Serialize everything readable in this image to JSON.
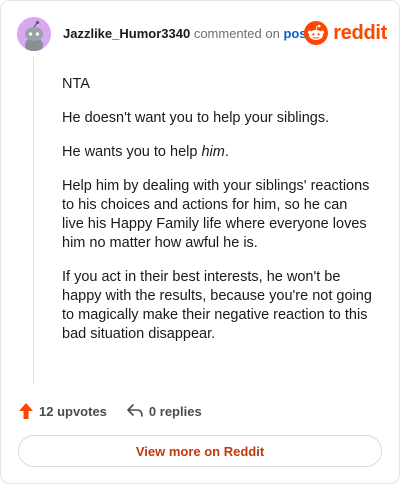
{
  "header": {
    "username": "Jazzlike_Humor3340",
    "commented_on": "commented on",
    "post_link": "post",
    "brand": "reddit",
    "avatar_icon": "snoo-avatar-icon",
    "brand_icon": "reddit-logo-icon"
  },
  "comment": {
    "paragraphs": [
      "NTA",
      "He doesn't want you to help your siblings.",
      "He wants you to help him.",
      "Help him by dealing with your siblings' reactions to his choices and actions for him, so he can live his Happy Family life where everyone loves him no matter how awful he is.",
      "If you act in their best interests, he won't be happy with the results, because you're not going to magically make their negative reaction to this bad situation disappear."
    ],
    "p3_prefix": "He wants you to help ",
    "p3_emphasis": "him",
    "p3_suffix": "."
  },
  "actions": {
    "upvotes": "12 upvotes",
    "replies": "0 replies",
    "upvote_icon": "upvote-arrow-icon",
    "reply_icon": "reply-arrow-icon"
  },
  "footer": {
    "view_more": "View more on Reddit"
  },
  "colors": {
    "brand": "#ff4500",
    "link": "#0b5ec3",
    "avatar_bg": "#d9a8f2",
    "button_text": "#c23a07"
  }
}
